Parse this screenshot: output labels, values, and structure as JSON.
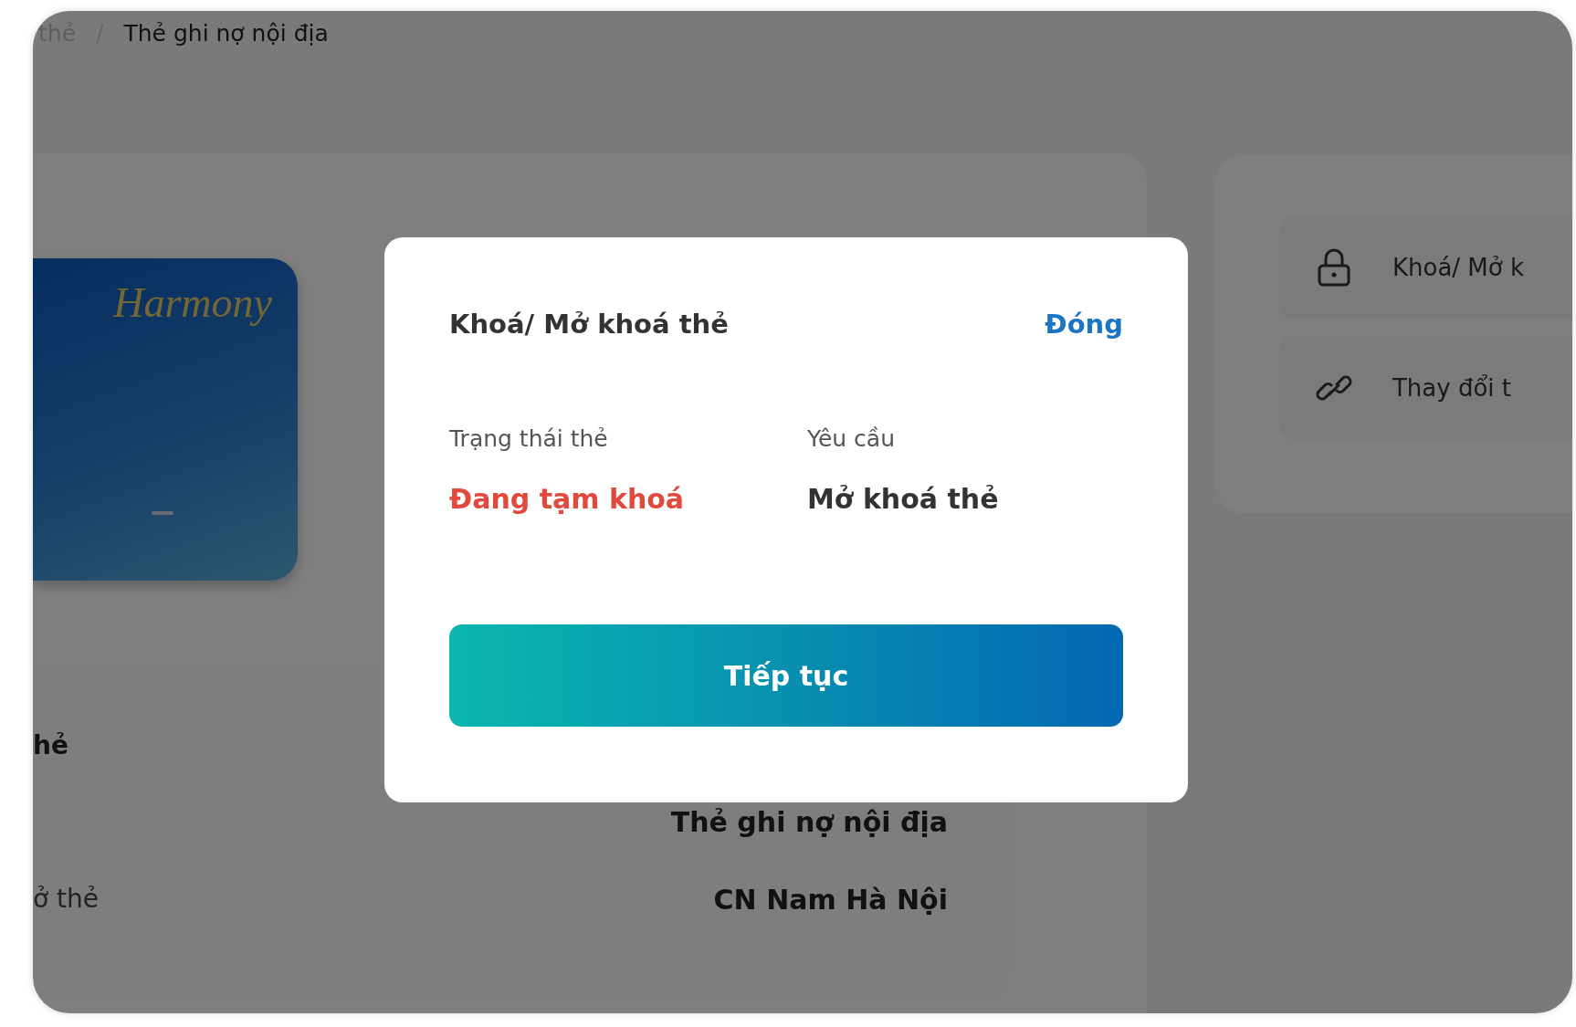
{
  "breadcrumb": [
    {
      "label": "thẻ",
      "current": false
    },
    {
      "label": "Thẻ ghi nợ nội địa",
      "current": true
    }
  ],
  "breadcrumb_separator": "/",
  "card": {
    "brand": "Harmony"
  },
  "details": {
    "heading": "hẻ",
    "rows": [
      {
        "value": "Thẻ ghi nợ nội địa"
      },
      {
        "label": "ở thẻ",
        "value": "CN Nam Hà Nội"
      }
    ]
  },
  "actions": [
    {
      "kind": "lock",
      "label": "Khoá/ Mở k"
    },
    {
      "kind": "link",
      "label": "Thay đổi t"
    }
  ],
  "modal": {
    "title": "Khoá/ Mở khoá thẻ",
    "close": "Đóng",
    "fields": [
      {
        "label": "Trạng thái thẻ",
        "value": "Đang tạm khoá",
        "kind": "alert"
      },
      {
        "label": "Yêu cầu",
        "value": "Mở khoá thẻ",
        "kind": "normal"
      }
    ],
    "button": "Tiếp tục"
  }
}
